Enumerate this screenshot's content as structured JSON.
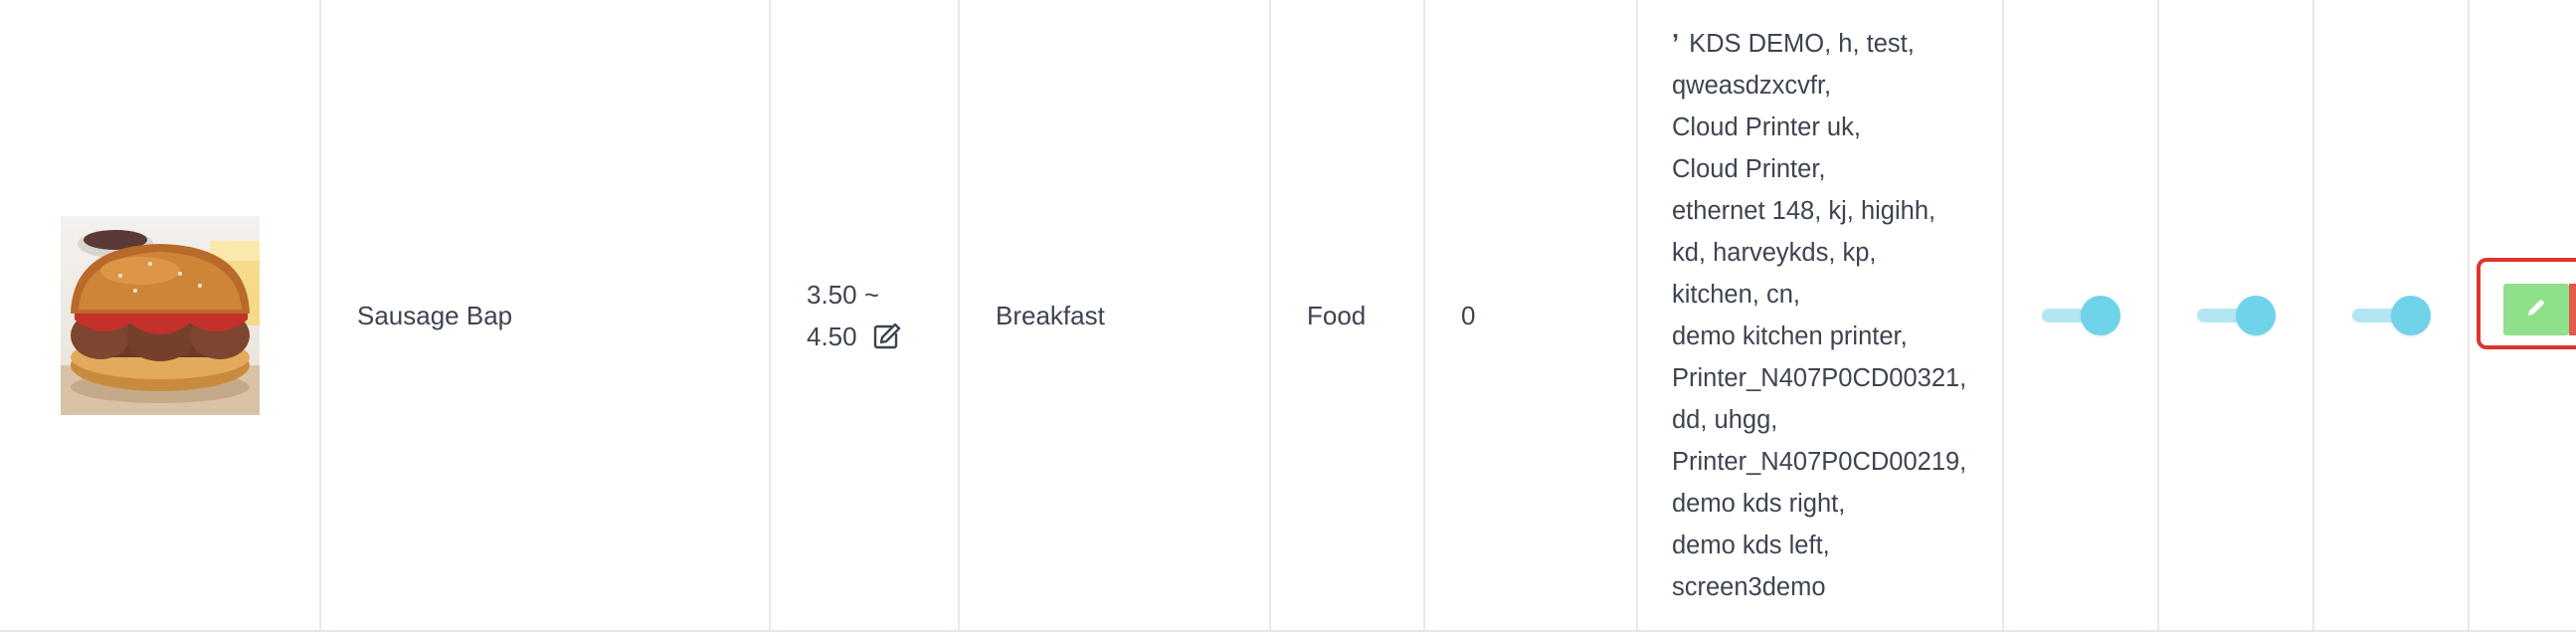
{
  "row": {
    "image": {
      "alt": "Sausage Bap"
    },
    "name": "Sausage Bap",
    "price": {
      "line1": "3.50 ~",
      "line2": "4.50"
    },
    "category": "Breakfast",
    "type": "Food",
    "stock": "0",
    "printers_lead": "ʼ",
    "printers": [
      "KDS DEMO, h, test,",
      "qweasdzxcvfr,",
      "Cloud Printer uk,",
      "Cloud Printer,",
      "ethernet 148, kj, higihh,",
      "kd, harveykds, kp,",
      "kitchen, cn,",
      "demo kitchen printer,",
      "Printer_N407P0CD00321,",
      "dd, uhgg,",
      "Printer_N407P0CD00219,",
      "demo kds right,",
      "demo kds left,",
      "screen3demo"
    ],
    "toggles": [
      true,
      true,
      true
    ]
  },
  "icons": {
    "price_edit": "edit-square-icon",
    "row_edit": "pencil-icon"
  },
  "colors": {
    "toggle_track": "#b3e6f2",
    "toggle_knob": "#6fd3ea",
    "edit_button": "#8fe08b",
    "highlight_border": "#e0352f"
  }
}
